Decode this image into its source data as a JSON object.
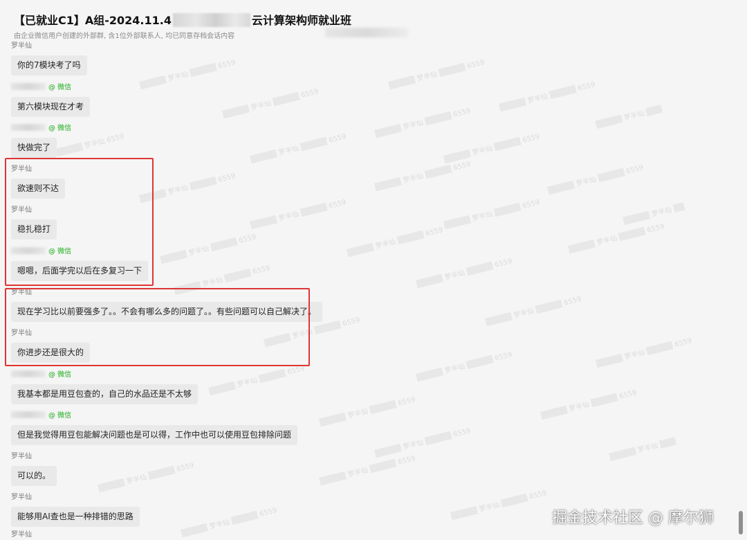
{
  "header": {
    "title_prefix": "【已就业C1】A组-2024.11.4",
    "title_suffix": "云计算架构师就业班",
    "subtitle": "由企业微信用户创建的外部群, 含1位外部联系人, 均已同意存档会话内容"
  },
  "wechat_tag": "@ 微信",
  "messages": [
    {
      "sender": "罗半仙",
      "text": "你的7模块考了吗",
      "external": false
    },
    {
      "sender": "",
      "text": "第六模块现在才考",
      "external": true
    },
    {
      "sender": "",
      "text": "快做完了",
      "external": true
    },
    {
      "sender": "罗半仙",
      "text": "欲速则不达",
      "external": false
    },
    {
      "sender": "罗半仙",
      "text": "稳扎稳打",
      "external": false
    },
    {
      "sender": "",
      "text": "嗯嗯，后面学完以后在多复习一下",
      "external": true
    },
    {
      "sender": "罗半仙",
      "text": "现在学习比以前要强多了。。不会有哪么多的问题了。。有些问题可以自己解决了。",
      "external": false
    },
    {
      "sender": "罗半仙",
      "text": "你进步还是很大的",
      "external": false
    },
    {
      "sender": "",
      "text": "我基本都是用豆包查的，自己的水品还是不太够",
      "external": true
    },
    {
      "sender": "",
      "text": "但是我觉得用豆包能解决问题也是可以得，工作中也可以使用豆包排除问题",
      "external": true
    },
    {
      "sender": "罗半仙",
      "text": "可以的。",
      "external": false
    },
    {
      "sender": "罗半仙",
      "text": "能够用AI查也是一种排错的思路",
      "external": false
    },
    {
      "sender": "罗半仙",
      "text": "",
      "external": false
    }
  ],
  "footer_watermark": "掘金技术社区 @ 摩尔狮",
  "colors": {
    "highlight": "#e03434",
    "wechat_green": "#1aad19",
    "bubble": "#e9e9e9"
  }
}
